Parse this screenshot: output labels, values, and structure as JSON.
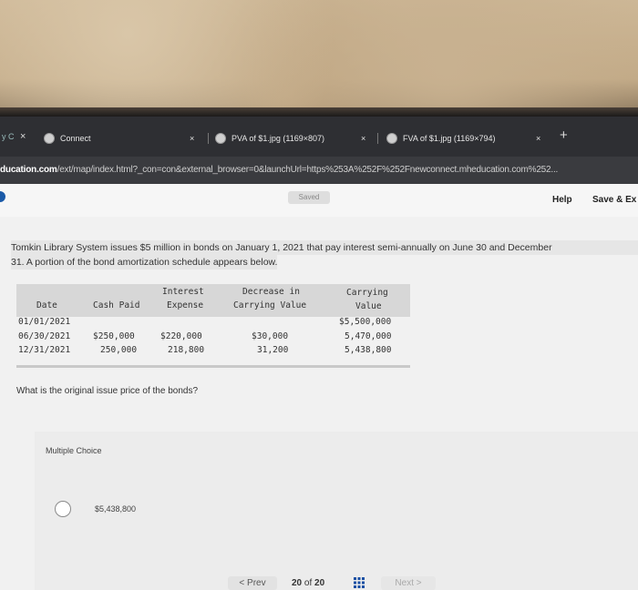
{
  "browser": {
    "tabs": [
      {
        "label": "Connect",
        "close": "×"
      },
      {
        "label": "PVA of $1.jpg (1169×807)",
        "close": "×"
      },
      {
        "label": "FVA of $1.jpg (1169×794)",
        "close": "×"
      }
    ],
    "left_close": "×",
    "new_tab": "+",
    "url_host": "ducation.com",
    "url_rest": "/ext/map/index.html?_con=con&external_browser=0&launchUrl=https%253A%252F%252Fnewconnect.mheducation.com%252..."
  },
  "header": {
    "saved": "Saved",
    "help": "Help",
    "save_exit": "Save & Ex"
  },
  "question": {
    "line1": "Tomkin Library System issues $5 million in bonds on January 1, 2021 that pay interest semi-annually on June 30 and December",
    "line2": "31. A portion of the bond amortization schedule appears below."
  },
  "table": {
    "headers": {
      "date": "Date",
      "cash_paid": "Cash Paid",
      "interest_1": "Interest",
      "interest_2": "Expense",
      "decrease_1": "Decrease in",
      "decrease_2": "Carrying Value",
      "carrying_1": "Carrying",
      "carrying_2": "Value"
    },
    "rows": [
      {
        "date": "01/01/2021",
        "cash_paid": "",
        "interest": "",
        "decrease": "",
        "carrying": "$5,500,000"
      },
      {
        "date": "06/30/2021",
        "cash_paid": "$250,000",
        "interest": "$220,000",
        "decrease": "$30,000",
        "carrying": "5,470,000"
      },
      {
        "date": "12/31/2021",
        "cash_paid": "250,000",
        "interest": "218,800",
        "decrease": "31,200",
        "carrying": "5,438,800"
      }
    ]
  },
  "prompt": "What is the original issue price of the bonds?",
  "choices": {
    "label": "Multiple Choice",
    "options": [
      {
        "label": "$5,438,800"
      }
    ]
  },
  "nav": {
    "prev": "< Prev",
    "current": "20",
    "of": "of",
    "total": "20",
    "next": "Next >"
  }
}
